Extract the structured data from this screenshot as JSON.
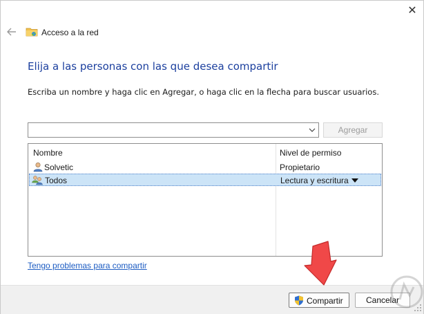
{
  "window": {
    "title": "Acceso a la red",
    "close_glyph": "✕",
    "back_glyph": "←"
  },
  "heading": "Elija a las personas con las que desea compartir",
  "instructions": "Escriba un nombre y haga clic en Agregar, o haga clic en la flecha para buscar usuarios.",
  "name_input": {
    "value": "",
    "placeholder": ""
  },
  "add_button": "Agregar",
  "list": {
    "headers": {
      "name": "Nombre",
      "permission": "Nivel de permiso"
    },
    "rows": [
      {
        "name": "Solvetic",
        "permission": "Propietario",
        "icon": "user-icon",
        "selected": false
      },
      {
        "name": "Todos",
        "permission": "Lectura y escritura",
        "icon": "users-group-icon",
        "selected": true
      }
    ]
  },
  "help_link": "Tengo problemas para compartir",
  "footer": {
    "share_button": "Compartir",
    "cancel_button": "Cancelar"
  },
  "colors": {
    "heading": "#1b3f9e",
    "link": "#1b5bc2",
    "selection": "#cce4f7",
    "annotation_arrow": "#f04848"
  }
}
